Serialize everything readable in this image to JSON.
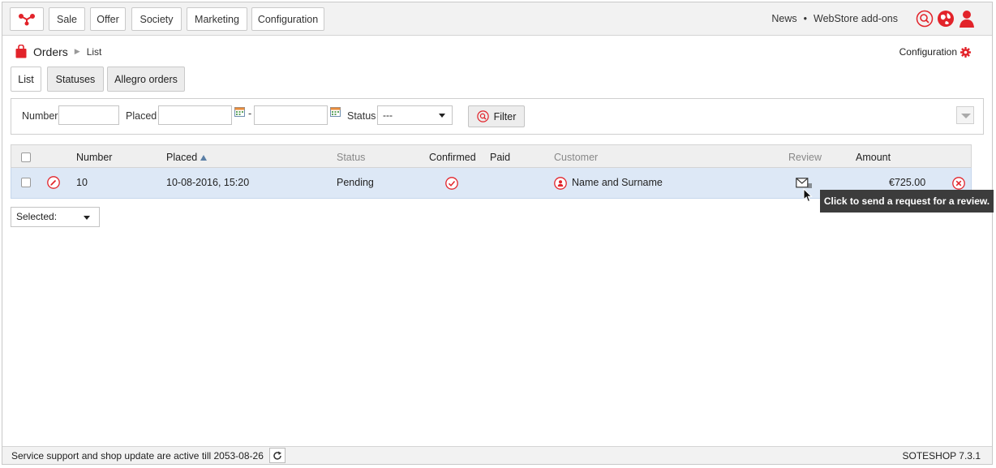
{
  "nav": {
    "items": [
      "Sale",
      "Offer",
      "Society",
      "Marketing",
      "Configuration"
    ],
    "news": "News",
    "separator": "•",
    "addons": "WebStore add-ons"
  },
  "breadcrumb": {
    "section": "Orders",
    "page": "List"
  },
  "config_link": "Configuration",
  "tabs": [
    "List",
    "Statuses",
    "Allegro orders"
  ],
  "filter": {
    "number_label": "Number",
    "number_value": "",
    "placed_label": "Placed",
    "placed_from": "",
    "dash": "-",
    "placed_to": "",
    "status_label": "Status",
    "status_value": "---",
    "button_label": "Filter"
  },
  "table": {
    "headers": {
      "number": "Number",
      "placed": "Placed",
      "status": "Status",
      "confirmed": "Confirmed",
      "paid": "Paid",
      "customer": "Customer",
      "review": "Review",
      "amount": "Amount"
    },
    "rows": [
      {
        "number": "10",
        "placed": "10-08-2016, 15:20",
        "status": "Pending",
        "customer": "Name and Surname",
        "amount": "€725.00"
      }
    ]
  },
  "bulk": {
    "label": "Selected:"
  },
  "tooltip": "Click to send a request for a review.",
  "footer": {
    "service": "Service support and shop update are active till 2053-08-26",
    "version": "SOTESHOP 7.3.1"
  },
  "colors": {
    "accent": "#e2232a",
    "row_bg": "#dde8f6",
    "tooltip_bg": "#3c3c3c"
  },
  "icons": [
    "logo-icon",
    "search-icon",
    "globe-icon",
    "user-icon",
    "orders-bag-icon",
    "gear-icon",
    "calendar-icon",
    "edit-icon",
    "confirmed-check-icon",
    "customer-icon",
    "review-mail-icon",
    "delete-icon",
    "refresh-icon",
    "cursor-icon"
  ]
}
